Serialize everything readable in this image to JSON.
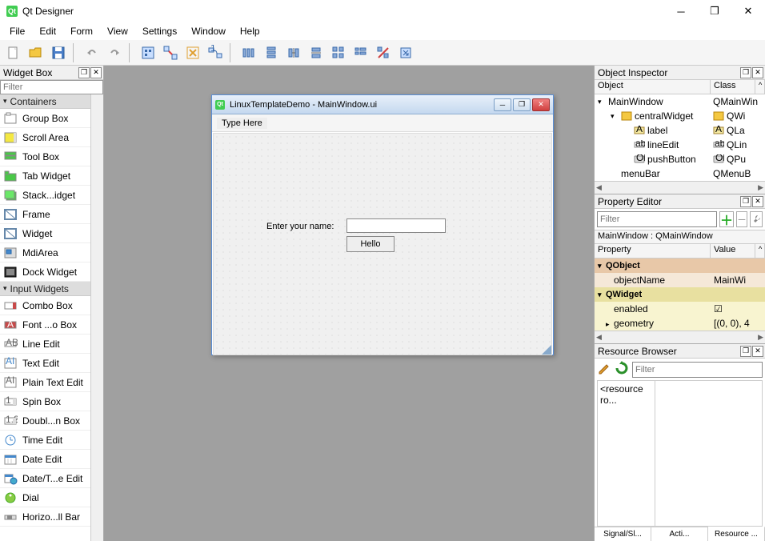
{
  "app": {
    "title": "Qt Designer"
  },
  "menubar": [
    "File",
    "Edit",
    "Form",
    "View",
    "Settings",
    "Window",
    "Help"
  ],
  "widget_box": {
    "title": "Widget Box",
    "filter_placeholder": "Filter",
    "groups": [
      {
        "name": "Containers",
        "items": [
          "Group Box",
          "Scroll Area",
          "Tool Box",
          "Tab Widget",
          "Stack...idget",
          "Frame",
          "Widget",
          "MdiArea",
          "Dock Widget"
        ]
      },
      {
        "name": "Input Widgets",
        "items": [
          "Combo Box",
          "Font ...o Box",
          "Line Edit",
          "Text Edit",
          "Plain Text Edit",
          "Spin Box",
          "Doubl...n Box",
          "Time Edit",
          "Date Edit",
          "Date/T...e Edit",
          "Dial",
          "Horizo...ll Bar"
        ]
      }
    ]
  },
  "design_form": {
    "title": "LinuxTemplateDemo - MainWindow.ui",
    "menubar_hint": "Type Here",
    "label": "Enter your name:",
    "button": "Hello"
  },
  "object_inspector": {
    "title": "Object Inspector",
    "headers": {
      "object": "Object",
      "class": "Class"
    },
    "rows": [
      {
        "indent": 0,
        "expand": "▾",
        "obj": "MainWindow",
        "cls": "QMainWin"
      },
      {
        "indent": 1,
        "expand": "▾",
        "obj": "centralWidget",
        "cls": "QWi",
        "icon": "widget"
      },
      {
        "indent": 2,
        "obj": "label",
        "cls": "QLa",
        "icon": "label"
      },
      {
        "indent": 2,
        "obj": "lineEdit",
        "cls": "QLin",
        "icon": "line"
      },
      {
        "indent": 2,
        "obj": "pushButton",
        "cls": "QPu",
        "icon": "button"
      },
      {
        "indent": 1,
        "obj": "menuBar",
        "cls": "QMenuB"
      }
    ]
  },
  "property_editor": {
    "title": "Property Editor",
    "filter_placeholder": "Filter",
    "context": "MainWindow : QMainWindow",
    "headers": {
      "prop": "Property",
      "value": "Value"
    },
    "groups": [
      {
        "name": "QObject",
        "cls": "obj",
        "props": [
          {
            "name": "objectName",
            "value": "MainWi"
          }
        ]
      },
      {
        "name": "QWidget",
        "cls": "wid",
        "props": [
          {
            "name": "enabled",
            "value": "☑"
          },
          {
            "name": "geometry",
            "value": "[(0, 0), 4",
            "expand": "▸"
          }
        ]
      }
    ]
  },
  "resource_browser": {
    "title": "Resource Browser",
    "filter_placeholder": "Filter",
    "root": "<resource ro...",
    "tabs": [
      "Signal/Sl...",
      "Acti...",
      "Resource ..."
    ]
  }
}
